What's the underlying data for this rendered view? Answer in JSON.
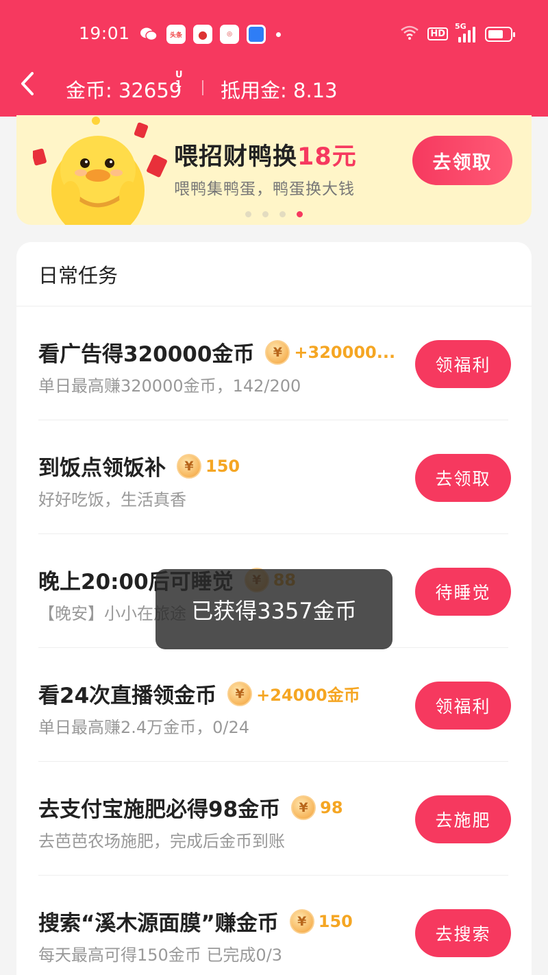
{
  "status_bar": {
    "time": "19:01",
    "icons": [
      "wechat-icon",
      "toutiao-icon",
      "app-icon",
      "app-icon",
      "app-icon"
    ],
    "toutiao_text": "头条",
    "battery_level": 0.7
  },
  "header": {
    "coins_label": "金币: 32659",
    "coins_sup": "U\n1",
    "deduct_label": "抵用金: 8.13"
  },
  "banner": {
    "title_main": "喂招财鸭换",
    "title_highlight": "18元",
    "subtitle": "喂鸭集鸭蛋，鸭蛋换大钱",
    "button": "去领取",
    "active_dot": 4,
    "dot_count": 4
  },
  "section_title": "日常任务",
  "coin_glyph": "¥",
  "tasks": [
    {
      "title": "看广告得320000金币",
      "reward": "+320000...",
      "desc": "单日最高赚320000金币，142/200",
      "button": "领福利"
    },
    {
      "title": "到饭点领饭补",
      "reward": "150",
      "desc": "好好吃饭，生活真香",
      "button": "去领取"
    },
    {
      "title": "晚上20:00后可睡觉",
      "reward": "88",
      "desc": "【晚安】小小在旅途",
      "button": "待睡觉"
    },
    {
      "title": "看24次直播领金币",
      "reward": "+24000金币",
      "desc": "单日最高赚2.4万金币，0/24",
      "button": "领福利"
    },
    {
      "title": "去支付宝施肥必得98金币",
      "reward": "98",
      "desc": "去芭芭农场施肥，完成后金币到账",
      "button": "去施肥"
    },
    {
      "title": "搜索“溪木源面膜”赚金币",
      "reward": "150",
      "desc": "每天最高可得150金币 已完成0/3",
      "button": "去搜索"
    }
  ],
  "toast": "已获得3357金币",
  "colors": {
    "brand": "#f6395f",
    "reward": "#f5a623",
    "banner_bg": "#fff5c8"
  }
}
